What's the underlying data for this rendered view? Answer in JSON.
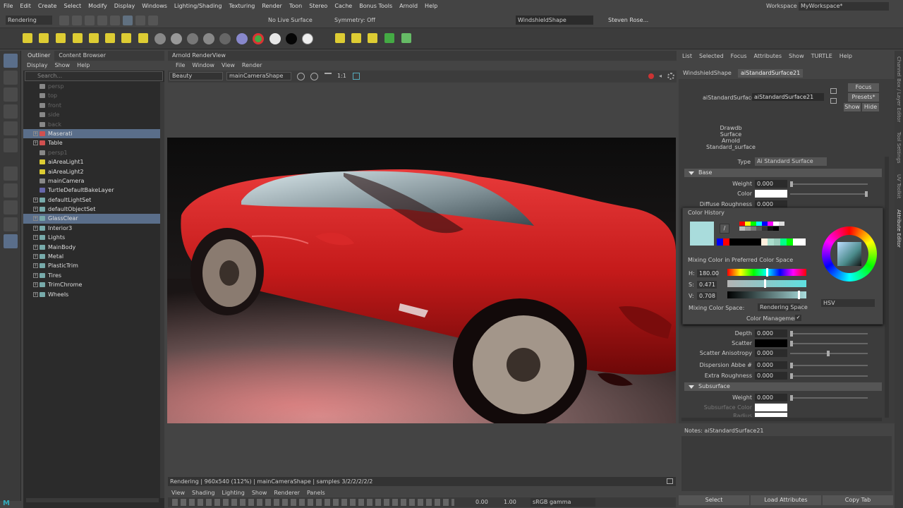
{
  "menubar": {
    "items": [
      "File",
      "Edit",
      "Create",
      "Select",
      "Modify",
      "Display",
      "Windows",
      "Lighting/Shading",
      "Texturing",
      "Render",
      "Toon",
      "Stereo",
      "Cache",
      "Bonus Tools",
      "Arnold",
      "Help"
    ],
    "workspace_label": "Workspace :",
    "workspace_value": "MyWorkspace*"
  },
  "statusline": {
    "mode": "Rendering",
    "live_surface": "No Live Surface",
    "symmetry": "Symmetry: Off",
    "object_field": "WindshieldShape",
    "user": "Steven Rose..."
  },
  "outliner": {
    "tabs": [
      "Outliner",
      "Content Browser"
    ],
    "menu": [
      "Display",
      "Show",
      "Help"
    ],
    "search_placeholder": "Search...",
    "items": [
      {
        "label": "persp",
        "dim": true,
        "icon": "camera"
      },
      {
        "label": "top",
        "dim": true,
        "icon": "camera"
      },
      {
        "label": "front",
        "dim": true,
        "icon": "camera"
      },
      {
        "label": "side",
        "dim": true,
        "icon": "camera"
      },
      {
        "label": "back",
        "dim": true,
        "icon": "camera"
      },
      {
        "label": "Maserati",
        "selected": true,
        "icon": "group",
        "plus": true
      },
      {
        "label": "Table",
        "icon": "group",
        "plus": true
      },
      {
        "label": "persp1",
        "dim": true,
        "icon": "camera"
      },
      {
        "label": "aiAreaLight1",
        "icon": "light"
      },
      {
        "label": "aiAreaLight2",
        "icon": "light"
      },
      {
        "label": "mainCamera",
        "icon": "camera"
      },
      {
        "label": "TurtleDefaultBakeLayer",
        "icon": "layer"
      },
      {
        "label": "defaultLightSet",
        "icon": "set",
        "plus": true
      },
      {
        "label": "defaultObjectSet",
        "icon": "set",
        "plus": true
      },
      {
        "label": "GlassClear",
        "icon": "set",
        "plus": true,
        "selected": true
      },
      {
        "label": "Interior3",
        "icon": "set",
        "plus": true
      },
      {
        "label": "Lights",
        "icon": "set",
        "plus": true
      },
      {
        "label": "MainBody",
        "icon": "set",
        "plus": true
      },
      {
        "label": "Metal",
        "icon": "set",
        "plus": true
      },
      {
        "label": "PlasticTrim",
        "icon": "set",
        "plus": true
      },
      {
        "label": "Tires",
        "icon": "set",
        "plus": true
      },
      {
        "label": "TrimChrome",
        "icon": "set",
        "plus": true
      },
      {
        "label": "Wheels",
        "icon": "set",
        "plus": true
      }
    ]
  },
  "renderview": {
    "title": "Arnold RenderView",
    "menu": [
      "File",
      "Window",
      "View",
      "Render"
    ],
    "aov": "Beauty",
    "camera": "mainCameraShape",
    "ratio": "1:1",
    "status": "Rendering | 960x540 (112%) | mainCameraShape | samples 3/2/2/2/2/2"
  },
  "viewport": {
    "menu": [
      "View",
      "Shading",
      "Lighting",
      "Show",
      "Renderer",
      "Panels"
    ],
    "exposure": "0.00",
    "gamma": "1.00",
    "colorspace": "sRGB gamma"
  },
  "attr_editor": {
    "menu": [
      "List",
      "Selected",
      "Focus",
      "Attributes",
      "Show",
      "TURTLE",
      "Help"
    ],
    "tabs": [
      "WindshieldShape",
      "aiStandardSurface21"
    ],
    "node_label": "aiStandardSurface:",
    "node_value": "aiStandardSurface21",
    "focus": "Focus",
    "presets": "Presets*",
    "show": "Show",
    "hide": "Hide",
    "swatch_lines": [
      "Drawdb",
      "Surface",
      "Arnold",
      "Standard_surface"
    ],
    "type_label": "Type",
    "type_value": "Ai Standard Surface",
    "base_header": "Base",
    "weight_label": "Weight",
    "weight_value": "0.000",
    "color_label": "Color",
    "diffuse_rough_label": "Diffuse Roughness",
    "diffuse_rough_value": "0.000",
    "depth_label": "Depth",
    "depth_value": "0.000",
    "scatter_label": "Scatter",
    "scatter_aniso_label": "Scatter Anisotropy",
    "scatter_aniso_value": "0.000",
    "dispersion_label": "Dispersion Abbe #",
    "dispersion_value": "0.000",
    "extra_rough_label": "Extra Roughness",
    "extra_rough_value": "0.000",
    "subsurface_header": "Subsurface",
    "ss_weight_label": "Weight",
    "ss_weight_value": "0.000",
    "ss_color_label": "Subsurface Color",
    "ss_radius_label": "Radius",
    "notes": "Notes:  aiStandardSurface21",
    "btn_select": "Select",
    "btn_load": "Load Attributes",
    "btn_copy": "Copy Tab"
  },
  "color_picker": {
    "history_label": "Color History",
    "mixing_label": "Mixing Color in Preferred Color Space",
    "h_label": "H:",
    "h_value": "180.00",
    "s_label": "S:",
    "s_value": "0.471",
    "v_label": "V:",
    "v_value": "0.708",
    "space_label": "Mixing Color Space:",
    "space_value": "Rendering Space",
    "mgmt_label": "Color Management",
    "mode": "HSV",
    "current_color": "#a9dcdc",
    "history_colors": [
      "#ff0000",
      "#ffff00",
      "#00ff00",
      "#00ffff",
      "#0000ff",
      "#ff00ff",
      "#ffffff",
      "#dddddd",
      "#bbbbbb",
      "#999999",
      "#777777",
      "#555555",
      "#333333",
      "#111111",
      "#000000"
    ],
    "bottom_colors": [
      "#0000ff",
      "#ff0000",
      "#000000",
      "#000000",
      "#000000",
      "#000000",
      "#000000",
      "#ffeedd",
      "#aaddcc",
      "#99ccbb",
      "#00ff88",
      "#00ff00",
      "#ffffff",
      "#ffffff"
    ]
  },
  "right_strip": [
    "Channel Box / Layer Editor",
    "Tool Settings",
    "UV Toolkit",
    "Attribute Editor"
  ]
}
